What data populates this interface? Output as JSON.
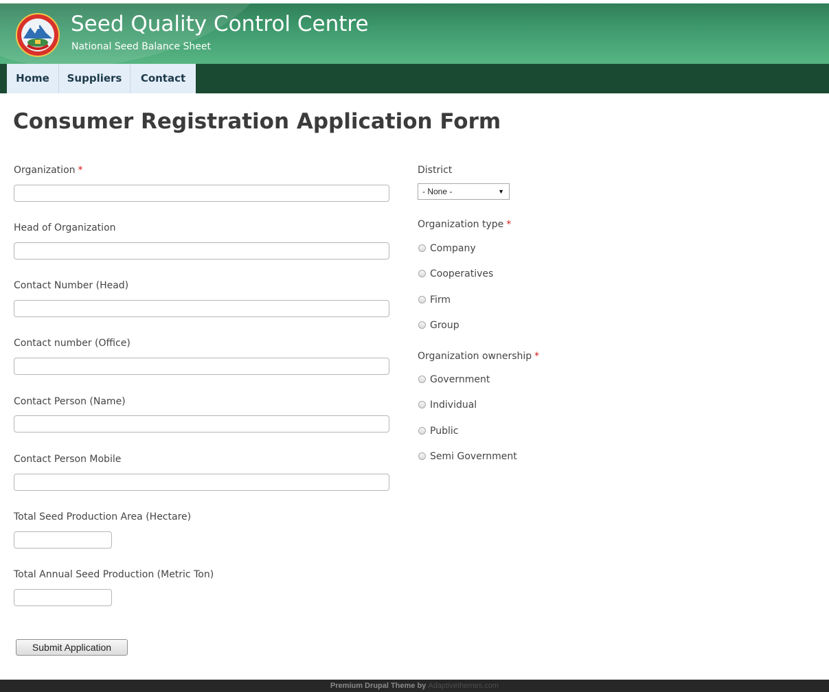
{
  "header": {
    "site_name": "Seed Quality Control Centre",
    "slogan": "National Seed Balance Sheet"
  },
  "nav": {
    "items": [
      {
        "label": "Home"
      },
      {
        "label": "Suppliers"
      },
      {
        "label": "Contact"
      }
    ]
  },
  "page_title": "Consumer Registration Application Form",
  "form": {
    "required_marker": "*",
    "organization": {
      "label": "Organization",
      "value": ""
    },
    "head_of_organization": {
      "label": "Head of Organization",
      "value": ""
    },
    "contact_number_head": {
      "label": "Contact Number (Head)",
      "value": ""
    },
    "contact_number_office": {
      "label": "Contact number (Office)",
      "value": ""
    },
    "contact_person_name": {
      "label": "Contact Person (Name)",
      "value": ""
    },
    "contact_person_mobile": {
      "label": "Contact Person Mobile",
      "value": ""
    },
    "total_seed_production_area": {
      "label": "Total Seed Production Area (Hectare)",
      "value": ""
    },
    "total_annual_seed_production": {
      "label": "Total Annual Seed Production (Metric Ton)",
      "value": ""
    },
    "district": {
      "label": "District",
      "selected": "- None -"
    },
    "organization_type": {
      "label": "Organization type",
      "options": [
        "Company",
        "Cooperatives",
        "Firm",
        "Group"
      ]
    },
    "organization_ownership": {
      "label": "Organization ownership",
      "options": [
        "Government",
        "Individual",
        "Public",
        "Semi Government"
      ]
    },
    "submit_label": "Submit Application"
  },
  "footer": {
    "text": "Premium Drupal Theme by",
    "link": "Adaptivethemes.com"
  },
  "colors": {
    "header_green": "#3f9a6d",
    "nav_dark_green": "#1b4a33",
    "nav_item_bg": "#e4eef8",
    "required_red": "#d71818",
    "footer_bg": "#272727"
  },
  "icons": [
    "national-emblem-logo-icon",
    "select-arrow-icon",
    "radio-icon"
  ]
}
